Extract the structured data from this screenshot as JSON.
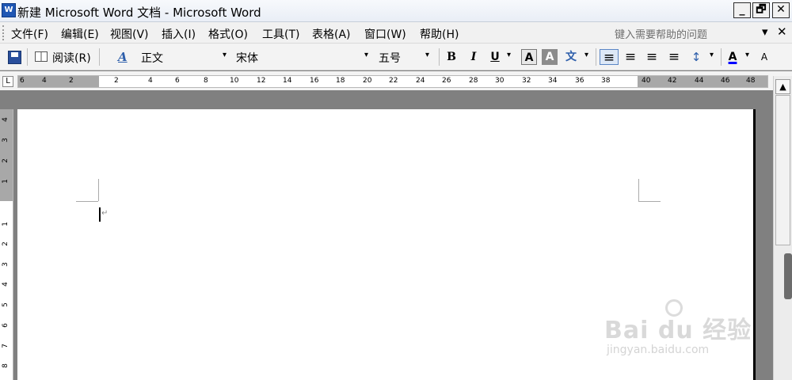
{
  "window": {
    "app_icon_text": "W",
    "title": "新建 Microsoft Word 文档 - Microsoft Word",
    "minimize": "_",
    "restore": "🗗",
    "close": "✕"
  },
  "menu": {
    "items": [
      "文件(F)",
      "编辑(E)",
      "视图(V)",
      "插入(I)",
      "格式(O)",
      "工具(T)",
      "表格(A)",
      "窗口(W)",
      "帮助(H)"
    ],
    "help_placeholder": "键入需要帮助的问题",
    "help_dropdown": "▾",
    "doc_close": "✕"
  },
  "toolbar": {
    "read_label": "阅读(R)",
    "style_icon": "A",
    "style_value": "正文",
    "font_value": "宋体",
    "size_value": "五号",
    "bold": "B",
    "italic": "I",
    "underline": "U",
    "char_border": "A",
    "char_shading": "A",
    "phonetic": "文",
    "align_left": "≡",
    "center": "≡",
    "align_right": "≡",
    "justify": "≡",
    "line_spacing": "↕",
    "font_color": "A",
    "grow_font": "A",
    "dropdown": "▾"
  },
  "ruler": {
    "corner": "L",
    "h_labels": [
      "6",
      "4",
      "2",
      "2",
      "4",
      "6",
      "8",
      "10",
      "12",
      "14",
      "16",
      "18",
      "20",
      "22",
      "24",
      "26",
      "28",
      "30",
      "32",
      "34",
      "36",
      "38",
      "40",
      "42",
      "44",
      "46",
      "48"
    ],
    "v_labels": [
      "4",
      "3",
      "2",
      "1",
      "1",
      "2",
      "3",
      "4",
      "5",
      "6",
      "7",
      "8"
    ]
  },
  "scrollbar": {
    "up_arrow": "▲"
  },
  "document": {
    "paragraph_mark": "↵"
  },
  "watermark": {
    "main": "Bai du 经验",
    "sub": "jingyan.baidu.com"
  }
}
